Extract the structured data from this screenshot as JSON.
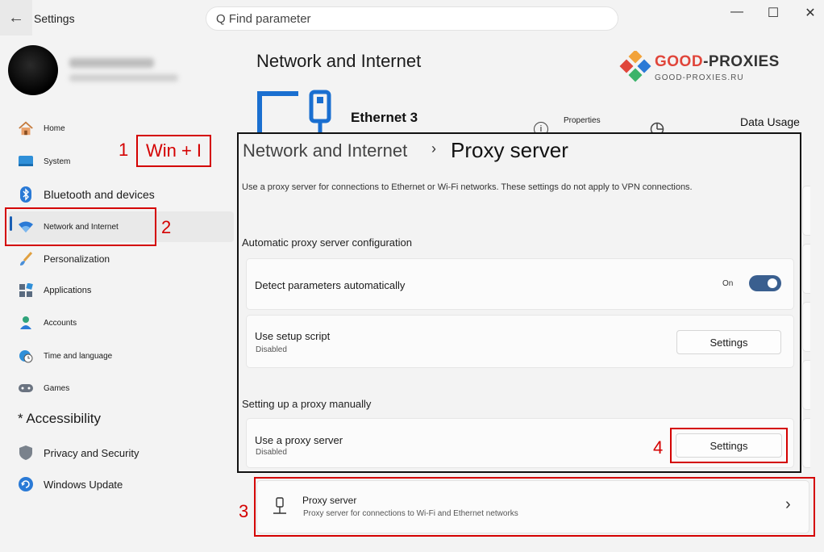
{
  "window": {
    "title": "Settings",
    "back_icon": "arrow-left-icon",
    "minimize": "—",
    "maximize": "☐",
    "close": "✕"
  },
  "search": {
    "placeholder": "Q Find parameter"
  },
  "sidebar": {
    "items": [
      {
        "label": "Home",
        "icon": "home-icon"
      },
      {
        "label": "System",
        "icon": "system-icon"
      },
      {
        "label": "Bluetooth and devices",
        "icon": "bluetooth-icon"
      },
      {
        "label": "Network and Internet",
        "icon": "wifi-icon",
        "active": true
      },
      {
        "label": "Personalization",
        "icon": "brush-icon"
      },
      {
        "label": "Applications",
        "icon": "apps-icon"
      },
      {
        "label": "Accounts",
        "icon": "person-icon"
      },
      {
        "label": "Time and language",
        "icon": "clock-globe-icon"
      },
      {
        "label": "Games",
        "icon": "gamepad-icon"
      },
      {
        "label": "* Accessibility",
        "icon": ""
      },
      {
        "label": "Privacy and Security",
        "icon": "shield-icon"
      },
      {
        "label": "Windows Update",
        "icon": "update-icon"
      }
    ]
  },
  "main": {
    "title": "Network and Internet",
    "ethernet_name": "Ethernet 3",
    "properties_label": "Properties",
    "data_usage_label": "Data Usage"
  },
  "logo": {
    "brand_good": "GOOD",
    "brand_rest": "-PROXIES",
    "sub": "GOOD-PROXIES.RU"
  },
  "proxy_panel": {
    "breadcrumb_parent": "Network and Internet",
    "breadcrumb_sep": "›",
    "breadcrumb_current": "Proxy server",
    "description": "Use a proxy server for connections to Ethernet or Wi-Fi networks. These settings do not apply to VPN connections.",
    "auto_section": "Automatic proxy server configuration",
    "detect_label": "Detect parameters automatically",
    "detect_state": "On",
    "script_label": "Use setup script",
    "script_status": "Disabled",
    "script_button": "Settings",
    "manual_section": "Setting up a proxy manually",
    "manual_label": "Use a proxy server",
    "manual_status": "Disabled",
    "manual_button": "Settings"
  },
  "proxy_nav": {
    "title": "Proxy server",
    "subtitle": "Proxy server for connections to Wi-Fi and Ethernet networks",
    "chevron": "›"
  },
  "annotations": {
    "step1_num": "1",
    "step1_text": "Win + I",
    "step2_num": "2",
    "step3_num": "3",
    "step4_num": "4"
  },
  "colors": {
    "annotation_red": "#d40000",
    "accent": "#1a5fb4",
    "toggle_on": "#3a5f8f"
  }
}
